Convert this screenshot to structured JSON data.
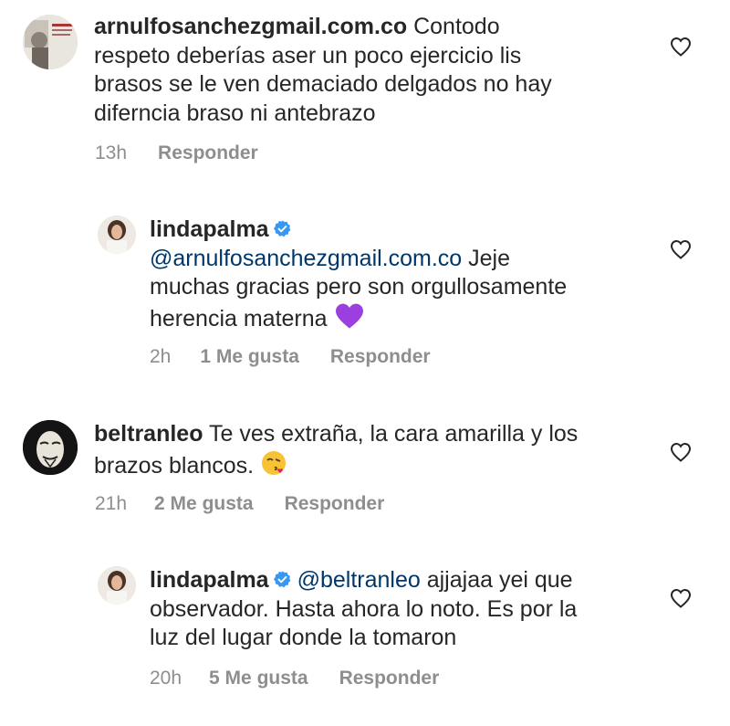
{
  "comments": [
    {
      "username": "arnulfosanchezgmail.com.co",
      "text": "Contodo respeto deberías aser un poco ejercicio lis brasos se le ven demaciado delgados no hay difernecia braso ni antebrazo",
      "line1_rest": " Contodo",
      "line2": "respeto deberías aser un poco ejercicio lis",
      "line3": "brasos se le ven demaciado delgados no hay",
      "line4": "diferncia braso ni antebrazo",
      "time": "13h",
      "reply_label": "Responder"
    },
    {
      "username": "lindapalma",
      "mention": "@arnulfosanchezgmail.com.co",
      "line1_rest": " Jeje",
      "line2": "muchas gracias pero son orgullosamente",
      "line3": "herencia materna",
      "emoji": "purple-heart",
      "time": "2h",
      "likes": "1 Me gusta",
      "reply_label": "Responder"
    },
    {
      "username": "beltranleo",
      "line1_rest": " Te ves extraña, la cara amarilla y los",
      "line2": "brazos blancos.",
      "emoji": "face-blowing-kiss",
      "time": "21h",
      "likes": "2 Me gusta",
      "reply_label": "Responder"
    },
    {
      "username": "lindapalma",
      "mention": "@beltranleo",
      "line1_rest": " ajjajaa yei que",
      "line2": "observador. Hasta ahora lo noto. Es por la",
      "line3": "luz del lugar donde la tomaron",
      "time": "20h",
      "likes": "5 Me gusta",
      "reply_label": "Responder"
    }
  ],
  "colors": {
    "text": "#262626",
    "secondary": "#8e8e8e",
    "mention": "#00376b",
    "verified": "#3897f0"
  }
}
